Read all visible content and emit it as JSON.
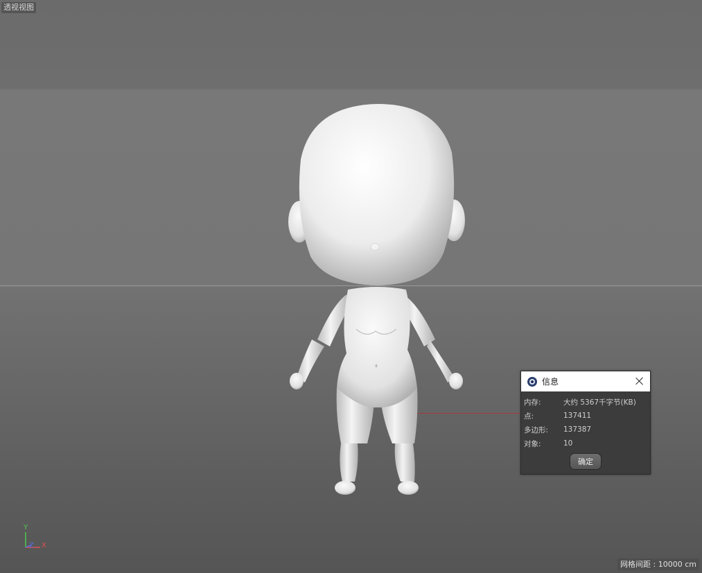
{
  "viewport": {
    "label": "透视视图",
    "grid_spacing": "网格间距 : 10000 cm"
  },
  "axes": {
    "y": "Y",
    "x": "X",
    "z": "Z"
  },
  "dialog": {
    "title": "信息",
    "icon": "cinema4d-icon",
    "rows": [
      {
        "label": "内存:",
        "value": "大约 5367千字节(KB)"
      },
      {
        "label": "点:",
        "value": "137411"
      },
      {
        "label": "多边形:",
        "value": "137387"
      },
      {
        "label": "对象:",
        "value": "10"
      }
    ],
    "ok_label": "确定"
  },
  "colors": {
    "axis_x": "#e05050",
    "axis_y": "#4ec94e",
    "axis_z": "#5b6fe0"
  }
}
